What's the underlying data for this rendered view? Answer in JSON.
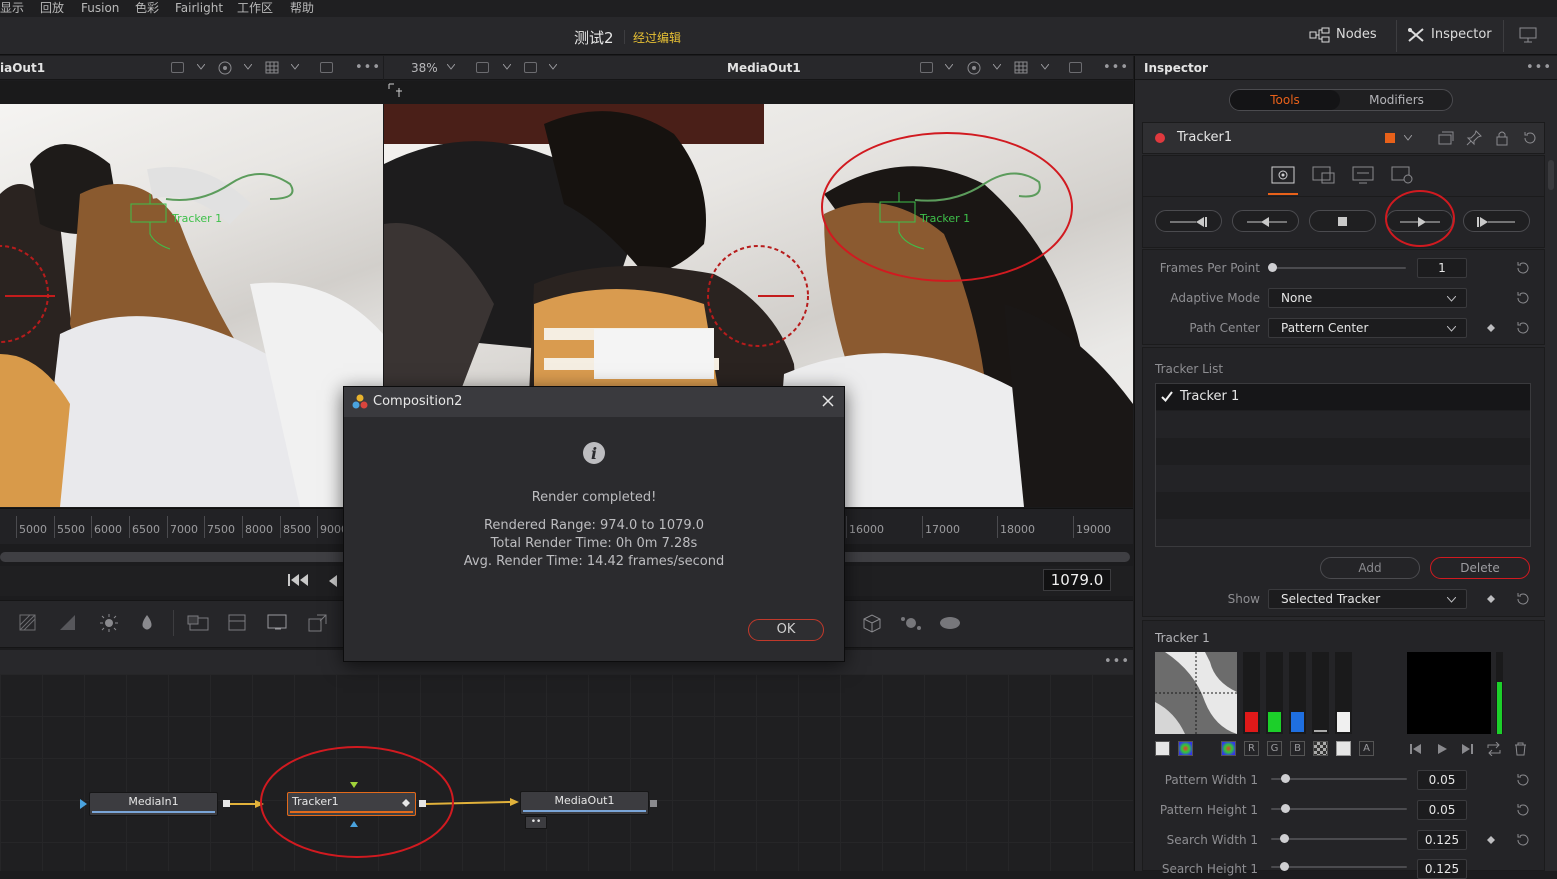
{
  "menu": [
    "显示",
    "回放",
    "Fusion",
    "色彩",
    "Fairlight",
    "工作区",
    "帮助"
  ],
  "title": {
    "project": "测试2",
    "status": "经过编辑"
  },
  "top_buttons": {
    "nodes": "Nodes",
    "inspector": "Inspector"
  },
  "viewer_left": {
    "title": "iaOut1"
  },
  "viewer_right": {
    "title": "MediaOut1",
    "zoom": "38%"
  },
  "overlay": {
    "tracker_label": "Tracker 1"
  },
  "ruler_left": [
    "5000",
    "5500",
    "6000",
    "6500",
    "7000",
    "7500",
    "8000",
    "8500",
    "9000"
  ],
  "ruler_right": [
    "16000",
    "17000",
    "18000",
    "19000"
  ],
  "frame": "1079.0",
  "dialog": {
    "title": "Composition2",
    "message": "Render completed!",
    "line1": "Rendered Range:   974.0 to 1079.0",
    "line2": "Total Render Time: 0h 0m 7.28s",
    "line3": "Avg. Render Time:  14.42 frames/second",
    "ok": "OK"
  },
  "nodes": {
    "in": "MediaIn1",
    "tracker": "Tracker1",
    "out": "MediaOut1"
  },
  "inspector": {
    "header": "Inspector",
    "tabs": {
      "tools": "Tools",
      "modifiers": "Modifiers"
    },
    "tool_name": "Tracker1",
    "accent": "#e8611a",
    "frames_per_point": {
      "label": "Frames Per Point",
      "value": "1",
      "fraction": 0.0
    },
    "adaptive_mode": {
      "label": "Adaptive Mode",
      "value": "None"
    },
    "path_center": {
      "label": "Path Center",
      "value": "Pattern Center"
    },
    "tracker_list": {
      "label": "Tracker List",
      "items": [
        "Tracker 1"
      ]
    },
    "add": "Add",
    "delete": "Delete",
    "show": {
      "label": "Show",
      "value": "Selected Tracker"
    },
    "tracker_section": "Tracker 1",
    "channels": [
      "R",
      "G",
      "B",
      "A"
    ],
    "pattern_width": {
      "label": "Pattern Width 1",
      "value": "0.05",
      "fraction": 0.05
    },
    "pattern_height": {
      "label": "Pattern Height 1",
      "value": "0.05",
      "fraction": 0.05
    },
    "search_width": {
      "label": "Search Width 1",
      "value": "0.125",
      "fraction": 0.125
    },
    "search_height": {
      "label": "Search Height 1",
      "value": "0.125",
      "fraction": 0.125
    }
  }
}
